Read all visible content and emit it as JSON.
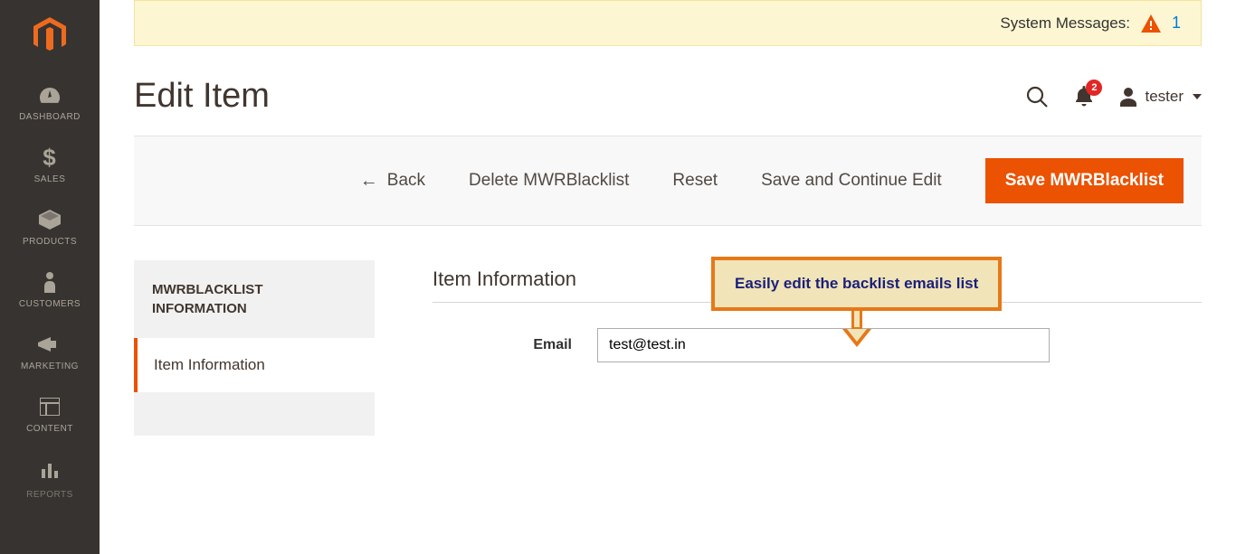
{
  "sidebar": {
    "items": [
      {
        "label": "DASHBOARD",
        "icon": "dashboard"
      },
      {
        "label": "SALES",
        "icon": "dollar"
      },
      {
        "label": "PRODUCTS",
        "icon": "cube"
      },
      {
        "label": "CUSTOMERS",
        "icon": "person"
      },
      {
        "label": "MARKETING",
        "icon": "megaphone"
      },
      {
        "label": "CONTENT",
        "icon": "layout"
      },
      {
        "label": "REPORTS",
        "icon": "bars"
      }
    ]
  },
  "system_messages": {
    "label": "System Messages:",
    "count": "1"
  },
  "header": {
    "title": "Edit Item",
    "notification_count": "2",
    "user": "tester"
  },
  "actions": {
    "back": "Back",
    "delete": "Delete MWRBlacklist",
    "reset": "Reset",
    "save_continue": "Save and Continue Edit",
    "save": "Save MWRBlacklist"
  },
  "side_panel": {
    "heading": "MWRBLACKLIST INFORMATION",
    "active_tab": "Item Information"
  },
  "form": {
    "section_title": "Item Information",
    "email_label": "Email",
    "email_value": "test@test.in"
  },
  "callout": {
    "text": "Easily edit the backlist emails list"
  }
}
